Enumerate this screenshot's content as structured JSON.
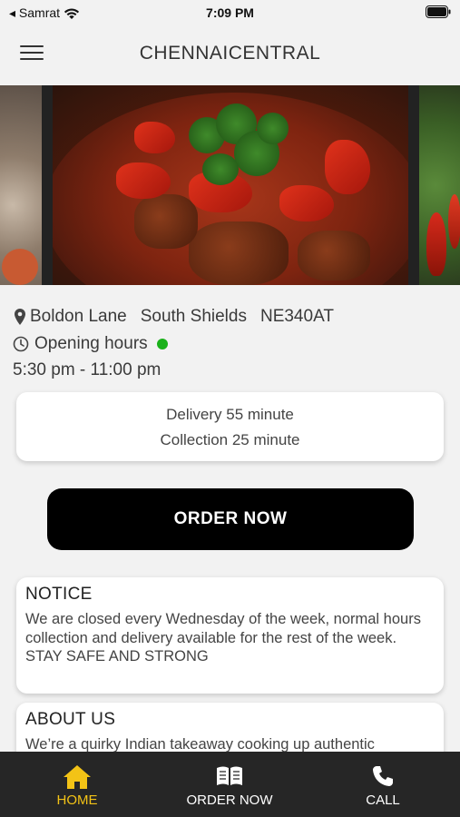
{
  "status_bar": {
    "carrier": "◂ Samrat",
    "time": "7:09 PM"
  },
  "header": {
    "title": "CHENNAICENTRAL"
  },
  "location": {
    "street": "Boldon Lane",
    "town": "South Shields",
    "postcode": "NE340AT"
  },
  "hours": {
    "label": "Opening hours",
    "time": "5:30 pm - 11:00 pm",
    "open_color": "#1ab11a"
  },
  "delivery": {
    "delivery_text": "Delivery 55 minute",
    "collection_text": "Collection 25 minute"
  },
  "order_button": {
    "label": "ORDER NOW"
  },
  "notice": {
    "title": "NOTICE",
    "body": "We are closed every Wednesday of the week, normal hours collection and delivery available for the rest of the week.",
    "footer": "STAY SAFE AND STRONG"
  },
  "about": {
    "title": "ABOUT US",
    "body": "We’re a quirky Indian takeaway cooking up authentic"
  },
  "tabs": [
    {
      "label": "HOME",
      "icon": "home-icon",
      "active": true
    },
    {
      "label": "ORDER NOW",
      "icon": "menu-book-icon",
      "active": false
    },
    {
      "label": "CALL",
      "icon": "phone-icon",
      "active": false
    }
  ],
  "colors": {
    "accent": "#f3c316",
    "tab_bar": "#262626",
    "button": "#000000"
  }
}
